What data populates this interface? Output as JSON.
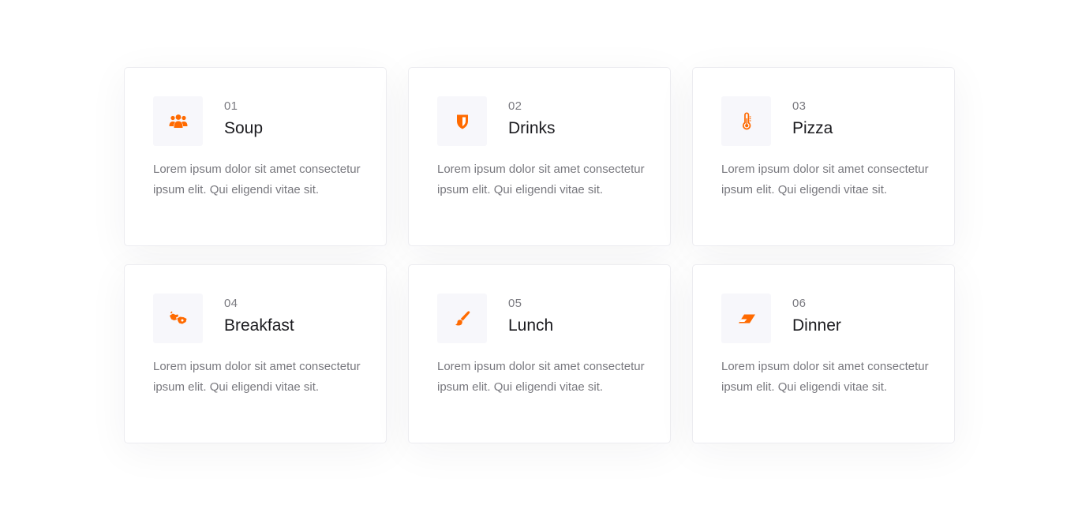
{
  "accent_color": "#ff6a00",
  "cards": [
    {
      "num": "01",
      "title": "Soup",
      "icon": "users-icon",
      "text": "Lorem ipsum dolor sit amet consectetur ipsum elit. Qui eligendi vitae sit."
    },
    {
      "num": "02",
      "title": "Drinks",
      "icon": "shield-icon",
      "text": "Lorem ipsum dolor sit amet consectetur ipsum elit. Qui eligendi vitae sit."
    },
    {
      "num": "03",
      "title": "Pizza",
      "icon": "thermometer-icon",
      "text": "Lorem ipsum dolor sit amet consectetur ipsum elit. Qui eligendi vitae sit."
    },
    {
      "num": "04",
      "title": "Breakfast",
      "icon": "sign-language-icon",
      "text": "Lorem ipsum dolor sit amet consectetur ipsum elit. Qui eligendi vitae sit."
    },
    {
      "num": "05",
      "title": "Lunch",
      "icon": "paint-brush-icon",
      "text": "Lorem ipsum dolor sit amet consectetur ipsum elit. Qui eligendi vitae sit."
    },
    {
      "num": "06",
      "title": "Dinner",
      "icon": "eraser-icon",
      "text": "Lorem ipsum dolor sit amet consectetur ipsum elit. Qui eligendi vitae sit."
    }
  ]
}
